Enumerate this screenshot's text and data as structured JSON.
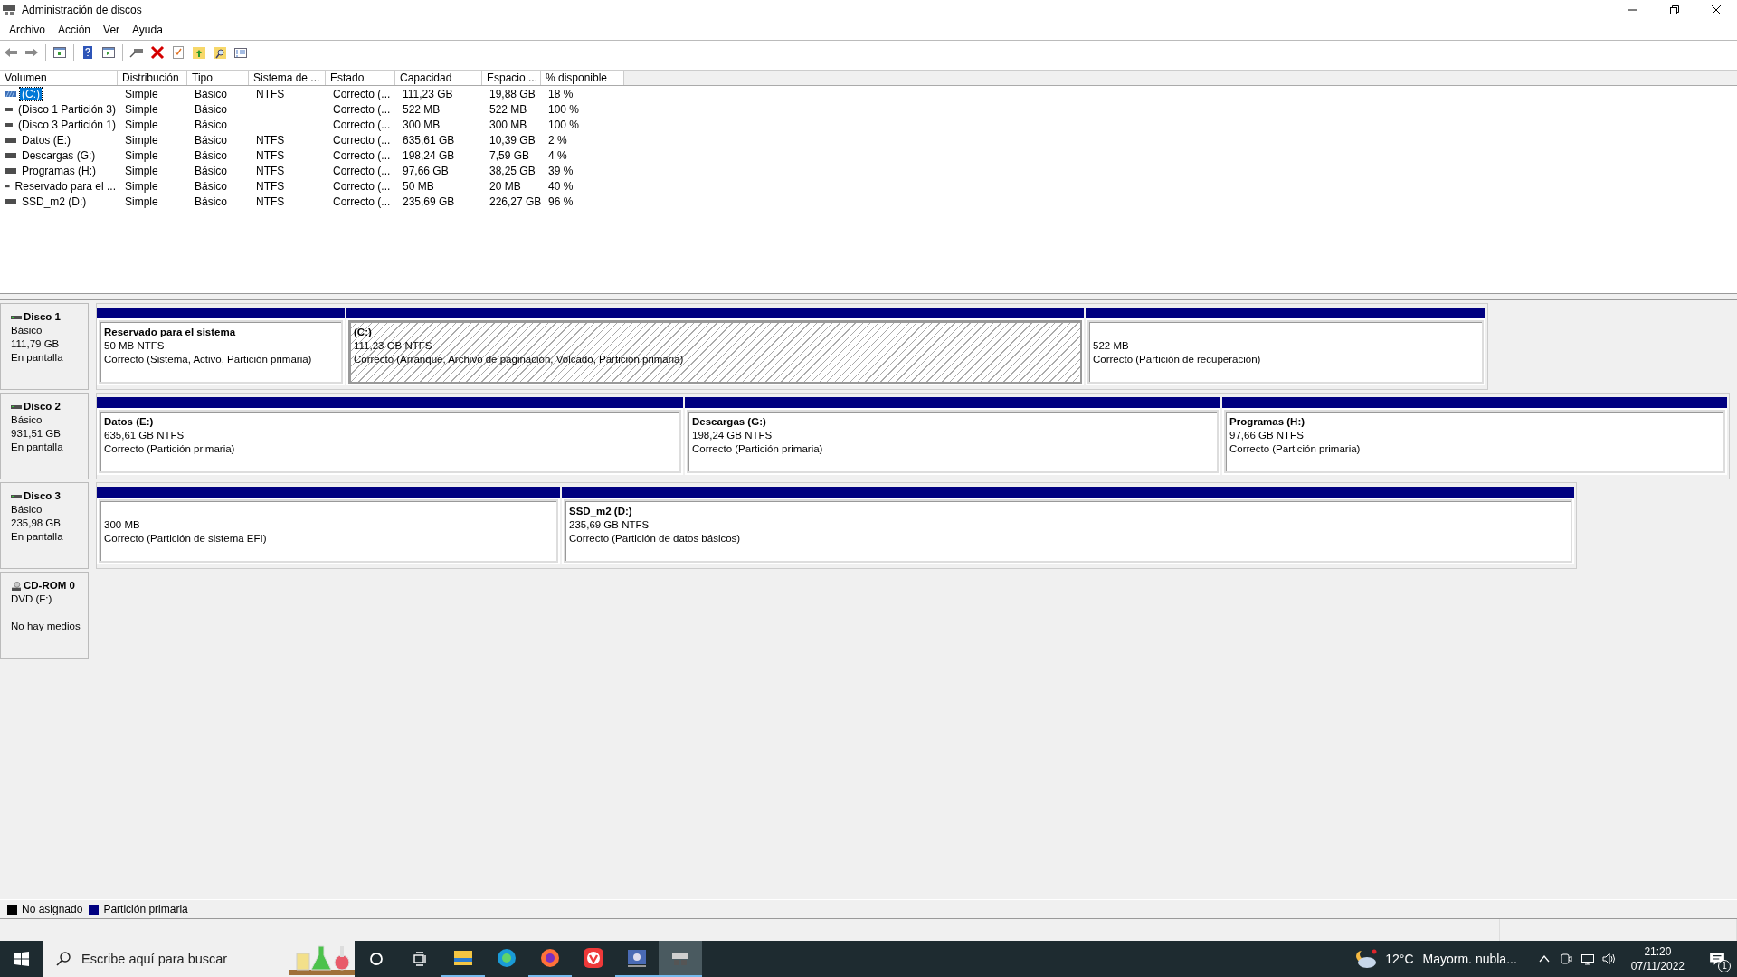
{
  "window": {
    "title": "Administración de discos"
  },
  "menu": [
    "Archivo",
    "Acción",
    "Ver",
    "Ayuda"
  ],
  "table": {
    "columns": [
      "Volumen",
      "Distribución",
      "Tipo",
      "Sistema de ...",
      "Estado",
      "Capacidad",
      "Espacio ...",
      "% disponible"
    ],
    "rows": [
      {
        "selected": true,
        "kind": "striped",
        "cells": [
          "(C:)",
          "Simple",
          "Básico",
          "NTFS",
          "Correcto (...",
          "111,23 GB",
          "19,88 GB",
          "18 %"
        ]
      },
      {
        "selected": false,
        "kind": "plain",
        "cells": [
          "(Disco 1 Partición 3)",
          "Simple",
          "Básico",
          "",
          "Correcto (...",
          "522 MB",
          "522 MB",
          "100 %"
        ]
      },
      {
        "selected": false,
        "kind": "plain",
        "cells": [
          "(Disco 3 Partición 1)",
          "Simple",
          "Básico",
          "",
          "Correcto (...",
          "300 MB",
          "300 MB",
          "100 %"
        ]
      },
      {
        "selected": false,
        "kind": "plain",
        "cells": [
          "Datos (E:)",
          "Simple",
          "Básico",
          "NTFS",
          "Correcto (...",
          "635,61 GB",
          "10,39 GB",
          "2 %"
        ]
      },
      {
        "selected": false,
        "kind": "plain",
        "cells": [
          "Descargas (G:)",
          "Simple",
          "Básico",
          "NTFS",
          "Correcto (...",
          "198,24 GB",
          "7,59 GB",
          "4 %"
        ]
      },
      {
        "selected": false,
        "kind": "plain",
        "cells": [
          "Programas (H:)",
          "Simple",
          "Básico",
          "NTFS",
          "Correcto (...",
          "97,66 GB",
          "38,25 GB",
          "39 %"
        ]
      },
      {
        "selected": false,
        "kind": "plain",
        "cells": [
          "Reservado para el ...",
          "Simple",
          "Básico",
          "NTFS",
          "Correcto (...",
          "50 MB",
          "20 MB",
          "40 %"
        ]
      },
      {
        "selected": false,
        "kind": "plain",
        "cells": [
          "SSD_m2 (D:)",
          "Simple",
          "Básico",
          "NTFS",
          "Correcto (...",
          "235,69 GB",
          "226,27 GB",
          "96 %"
        ]
      }
    ]
  },
  "disks": [
    {
      "kind": "disk",
      "name": "Disco 1",
      "type": "Básico",
      "size": "111,79 GB",
      "status": "En pantalla",
      "partitions": [
        {
          "name": "Reservado para el sistema",
          "size": "50 MB NTFS",
          "status": "Correcto (Sistema, Activo, Partición primaria)",
          "selected": false
        },
        {
          "name": "(C:)",
          "size": "111,23 GB NTFS",
          "status": "Correcto (Arranque, Archivo de paginación, Volcado, Partición primaria)",
          "selected": true
        },
        {
          "size": "522 MB",
          "status": "Correcto (Partición de recuperación)",
          "selected": false
        }
      ]
    },
    {
      "kind": "disk",
      "name": "Disco 2",
      "type": "Básico",
      "size": "931,51 GB",
      "status": "En pantalla",
      "partitions": [
        {
          "name": "Datos  (E:)",
          "size": "635,61 GB NTFS",
          "status": "Correcto (Partición primaria)",
          "selected": false
        },
        {
          "name": "Descargas  (G:)",
          "size": "198,24 GB NTFS",
          "status": "Correcto (Partición primaria)",
          "selected": false
        },
        {
          "name": "Programas  (H:)",
          "size": "97,66 GB NTFS",
          "status": "Correcto (Partición primaria)",
          "selected": false
        }
      ]
    },
    {
      "kind": "disk",
      "name": "Disco 3",
      "type": "Básico",
      "size": "235,98 GB",
      "status": "En pantalla",
      "partitions": [
        {
          "size": "300 MB",
          "status": "Correcto (Partición de sistema EFI)",
          "selected": false
        },
        {
          "name": "SSD_m2  (D:)",
          "size": "235,69 GB NTFS",
          "status": "Correcto (Partición de datos básicos)",
          "selected": false
        }
      ]
    },
    {
      "kind": "cdrom",
      "name": "CD-ROM 0",
      "type": "DVD (F:)",
      "status": "No hay medios"
    }
  ],
  "legend": [
    {
      "label": "No asignado",
      "color": "#000000"
    },
    {
      "label": "Partición primaria",
      "color": "#000080"
    }
  ],
  "taskbar": {
    "search_placeholder": "Escribe aquí para buscar",
    "apps": [
      {
        "kind": "explorer",
        "running": true,
        "selected": false
      },
      {
        "kind": "edge",
        "running": false,
        "selected": false
      },
      {
        "kind": "firefox",
        "running": true,
        "selected": false
      },
      {
        "kind": "vivaldi",
        "running": false,
        "selected": false
      },
      {
        "kind": "network",
        "running": true,
        "selected": false
      },
      {
        "kind": "diskmgmt",
        "running": true,
        "selected": true
      }
    ],
    "temperature": "12°C",
    "weather": "Mayorm. nubla...",
    "time": "21:20",
    "date": "07/11/2022",
    "notifications": "1"
  }
}
